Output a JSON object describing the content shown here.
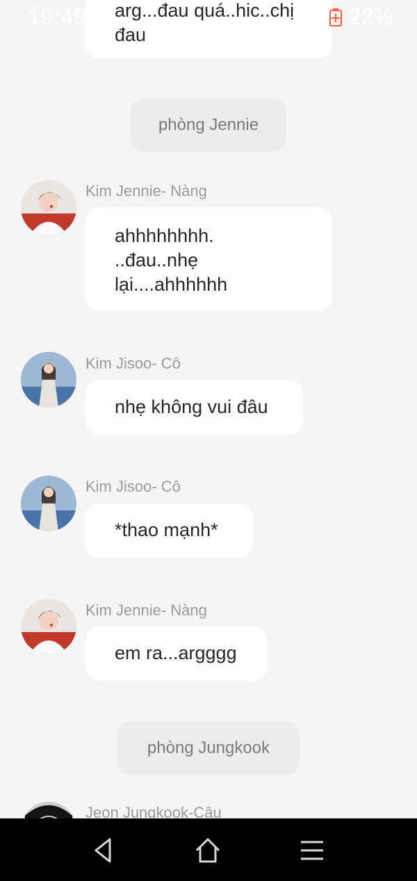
{
  "status_bar": {
    "time": "19:49",
    "battery_percent": "22%",
    "battery_icon": "battery-charging-icon"
  },
  "messages": [
    {
      "kind": "chat",
      "text": "arg...đau quá..hic..chị\nđau"
    },
    {
      "kind": "narration",
      "text": "phòng Jennie"
    },
    {
      "kind": "chat",
      "sender": "Kim Jennie- Nàng",
      "text": "ahhhhhhhh.\n..đau..nhẹ\nlại....ahhhhhh"
    },
    {
      "kind": "chat",
      "sender": "Kim Jisoo- Cô",
      "text": "nhẹ không vui đâu"
    },
    {
      "kind": "chat",
      "sender": "Kim Jisoo- Cô",
      "text": "*thao mạnh*"
    },
    {
      "kind": "chat",
      "sender": "Kim Jennie- Nàng",
      "text": "em ra...argggg"
    },
    {
      "kind": "narration",
      "text": "phòng Jungkook"
    },
    {
      "kind": "chat",
      "sender": "Jeon Jungkook-Cậu"
    }
  ],
  "nav_bar": {
    "back_icon": "back-triangle-icon",
    "home_icon": "home-icon",
    "menu_icon": "menu-icon"
  },
  "colors": {
    "background": "#f5f5f5",
    "bubble": "#ffffff",
    "narration": "#ececec",
    "name_text": "#9a9a9a",
    "message_text": "#262626",
    "battery": "#ff5a36",
    "nav_bar": "#000000"
  }
}
